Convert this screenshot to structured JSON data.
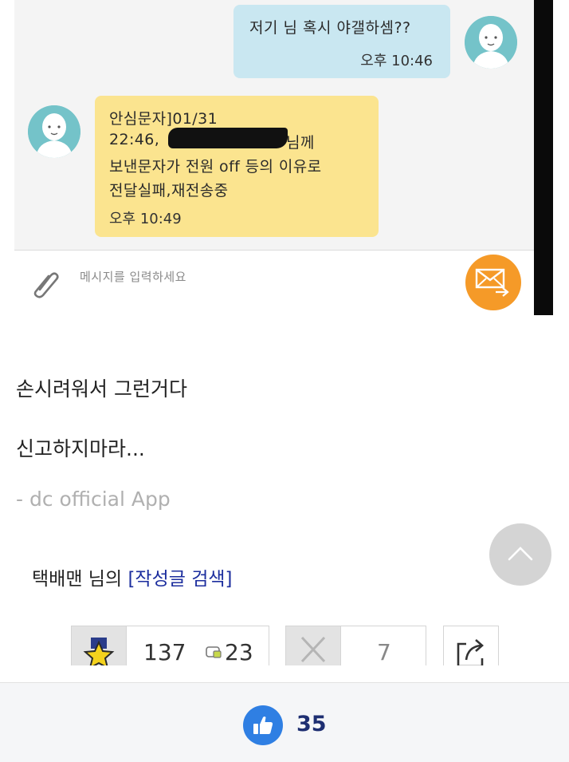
{
  "chat": {
    "outgoing": {
      "text": "저기 님 혹시 야갤하셈??",
      "time": "오후 10:46"
    },
    "incoming": {
      "lines": [
        "안심문자]01/31",
        "22:46,",
        "님께",
        "보낸문자가 전원 off 등의 이유로",
        "전달실패,재전송중"
      ],
      "time": "오후 10:49"
    },
    "input_placeholder": "메시지를 입력하세요"
  },
  "post": {
    "lines": [
      "손시려워서 그런거다",
      "신고하지마라..."
    ],
    "signature": "- dc official App"
  },
  "author": {
    "name": "택배맨",
    "suffix": " 님의 ",
    "link": "[작성글 검색]"
  },
  "votes": {
    "recommend": "137",
    "fix": "23",
    "not_recommend": "7"
  },
  "bottom": {
    "like_count": "35"
  },
  "colors": {
    "send_button": "#f59a28",
    "link": "#1c2e9e",
    "like": "#2f7fe3",
    "outgoing_bubble": "#c9e7f1",
    "incoming_bubble": "#fbe48f"
  }
}
